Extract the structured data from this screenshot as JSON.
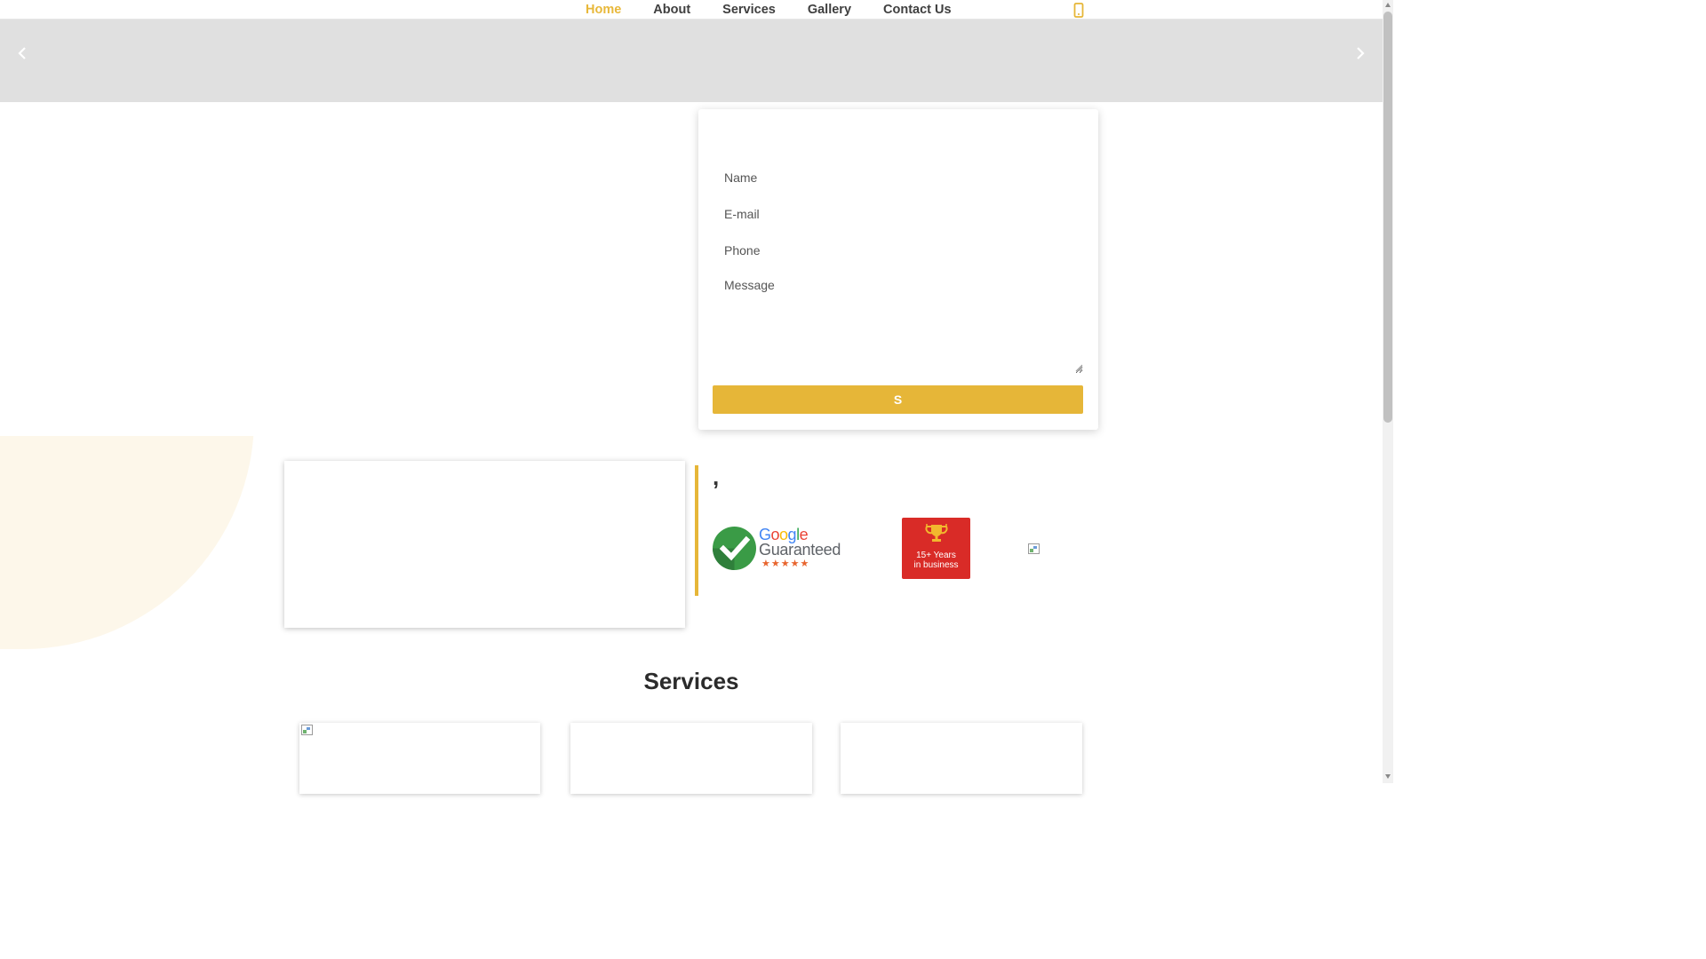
{
  "nav": {
    "items": [
      {
        "label": "Home",
        "active": true
      },
      {
        "label": "About",
        "active": false
      },
      {
        "label": "Services",
        "active": false
      },
      {
        "label": "Gallery",
        "active": false
      },
      {
        "label": "Contact Us",
        "active": false
      }
    ],
    "phone_icon": "mobile-phone-icon"
  },
  "slider": {
    "prev_icon": "chevron-left-icon",
    "next_icon": "chevron-right-icon"
  },
  "form": {
    "name_placeholder": "Name",
    "email_placeholder": "E-mail",
    "phone_placeholder": "Phone",
    "message_placeholder": "Message",
    "submit_label": "S"
  },
  "testimonial": {
    "quote_mark": ","
  },
  "badges": {
    "google": {
      "word": [
        "G",
        "o",
        "o",
        "g",
        "l",
        "e"
      ],
      "guaranteed": "Guaranteed",
      "stars": "★★★★★"
    },
    "years": {
      "line1": "15+ Years",
      "line2": "in business"
    }
  },
  "services": {
    "title": "Services"
  },
  "colors": {
    "accent": "#e6b638",
    "nav_active": "#e8b83a",
    "badge_red": "#d92b27",
    "google_green": "#3a9b46",
    "slider_bg": "#e0e0e0"
  }
}
